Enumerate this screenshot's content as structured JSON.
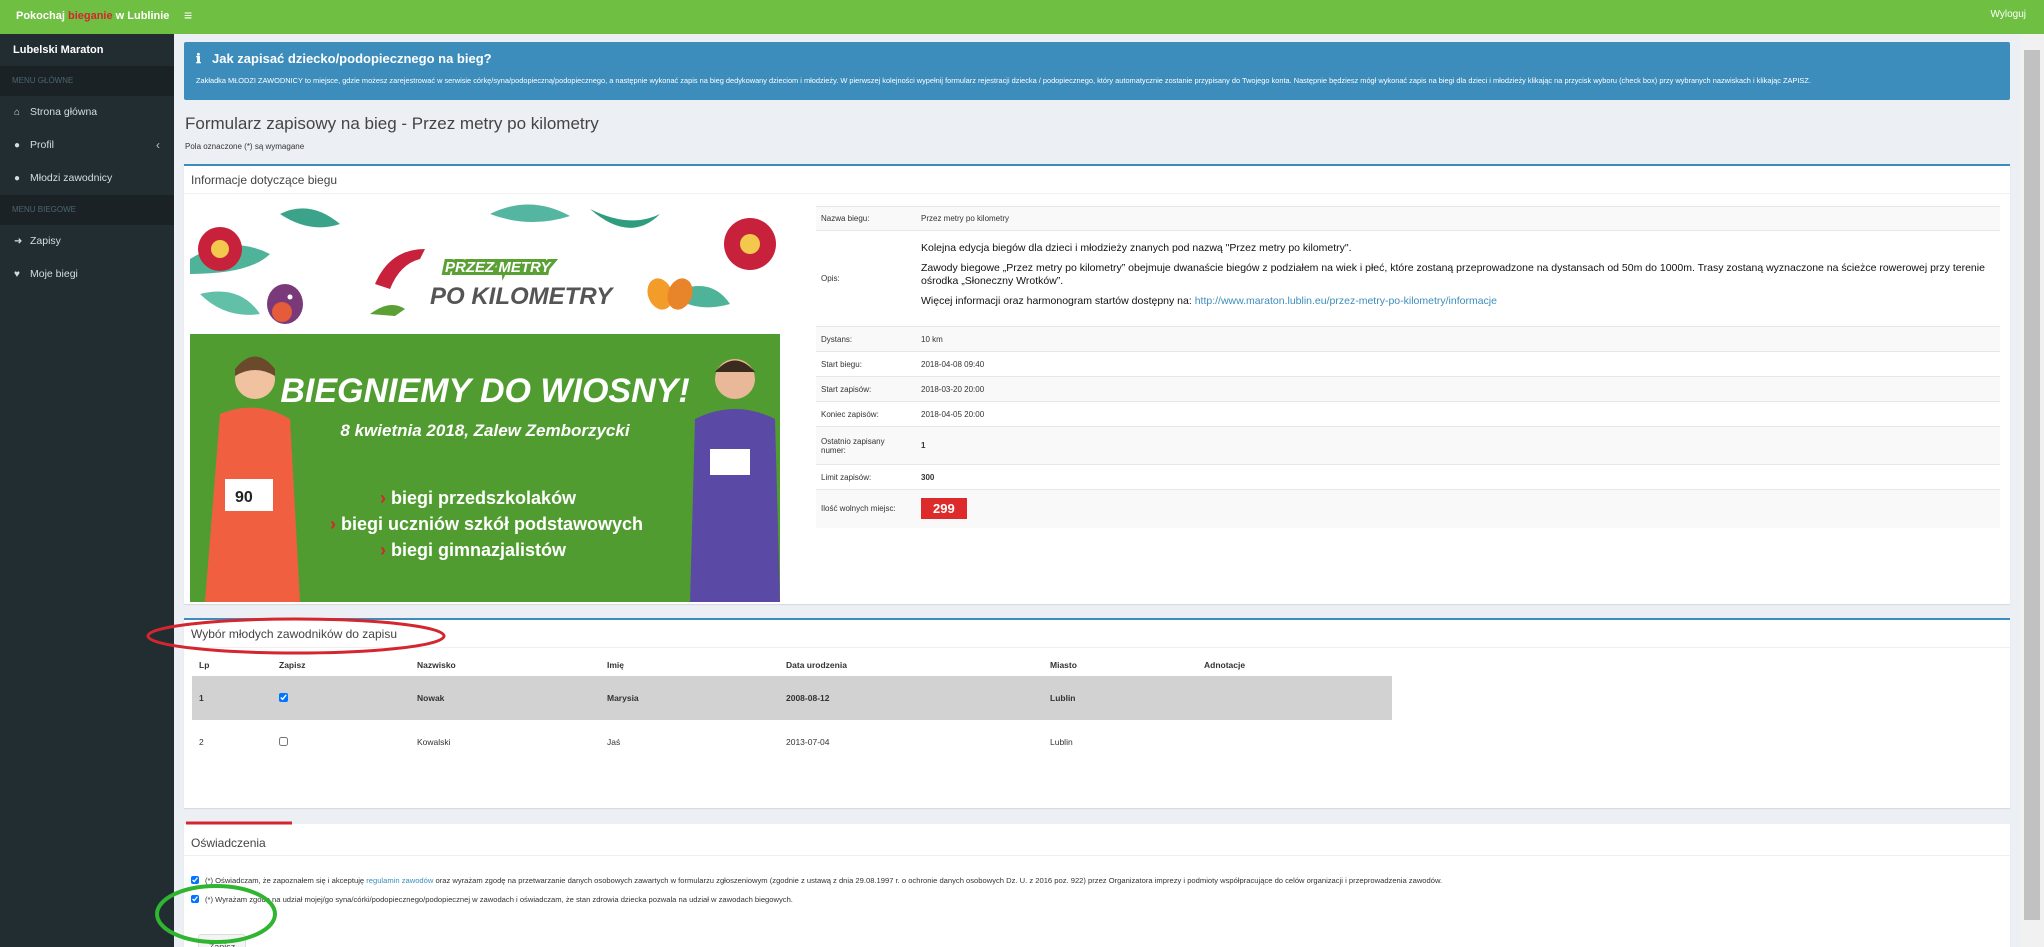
{
  "topbar": {
    "brand_pre": "Pokochaj ",
    "brand_hl": "bieganie",
    "brand_post": " w Lublinie",
    "logout": "Wyloguj",
    "brand_highlight_color": "#d3262e",
    "bar_color": "#6fc042"
  },
  "sidebar": {
    "user": "Lubelski Maraton",
    "header_main": "MENU GŁÓWNE",
    "header_runs": "MENU BIEGOWE",
    "items": [
      {
        "label": "Strona główna",
        "icon": "home-icon"
      },
      {
        "label": "Profil",
        "icon": "user-icon"
      },
      {
        "label": "Młodzi zawodnicy",
        "icon": "users-icon"
      },
      {
        "label": "Zapisy",
        "icon": "sign-in-icon"
      },
      {
        "label": "Moje biegi",
        "icon": "heart-icon"
      }
    ]
  },
  "callout": {
    "title": "Jak zapisać dziecko/podopiecznego na bieg?",
    "text": "Zakładka MŁODZI ZAWODNICY to miejsce, gdzie możesz zarejestrować w serwisie córkę/syna/podopieczną/podopiecznego, a następnie wykonać zapis na bieg dedykowany dzieciom i młodzieży. W pierwszej kolejności wypełnij formularz rejestracji dziecka / podopiecznego, który automatycznie zostanie przypisany do Twojego konta. Następnie będziesz mógł wykonać zapis na biegi dla dzieci i młodzieży klikając na przycisk wyboru (check box) przy wybranych nazwiskach i klikając ZAPISZ.",
    "color": "#3c8dbc"
  },
  "page": {
    "title": "Formularz zapisowy na bieg - Przez metry po kilometry",
    "subtitle": "Pola oznaczone (*) są wymagane"
  },
  "info_box": {
    "title": "Informacje dotyczące biegu",
    "banner": {
      "logo_top": "PRZEZ METRY",
      "logo_bottom": "PO KILOMETRY",
      "headline": "BIEGNIEMY DO WIOSNY!",
      "date": "8 kwietnia 2018, Zalew Zemborzycki",
      "bullets": [
        "biegi przedszkolaków",
        "biegi uczniów szkół podstawowych",
        "biegi gimnazjalistów"
      ],
      "bib": "90"
    },
    "rows": {
      "name_label": "Nazwa biegu:",
      "name": "Przez metry po kilometry",
      "opis_label": "Opis:",
      "opis_p1": "Kolejna edycja biegów dla dzieci i młodzieży  znanych pod nazwą \"Przez metry po kilometry\".",
      "opis_p2": "Zawody biegowe „Przez metry po kilometry” obejmuje dwanaście biegów z podziałem na wiek i płeć, które zostaną przeprowadzone na dystansach od 50m do 1000m. Trasy zostaną wyznaczone na ścieżce rowerowej przy terenie ośrodka „Słoneczny Wrotków”.",
      "opis_p3": "Więcej informacji oraz harmonogram startów dostępny na: ",
      "opis_link": "http://www.maraton.lublin.eu/przez-metry-po-kilometry/informacje",
      "distance_label": "Dystans:",
      "distance": "10 km",
      "start_label": "Start biegu:",
      "start": "2018-04-08 09:40",
      "reg_start_label": "Start zapisów:",
      "reg_start": "2018-03-20 20:00",
      "reg_end_label": "Koniec zapisów:",
      "reg_end": "2018-04-05 20:00",
      "last_no_label": "Ostatnio zapisany numer:",
      "last_no": "1",
      "limit_label": "Limit zapisów:",
      "limit": "300",
      "free_label": "Ilość wolnych miejsc:",
      "free": "299",
      "badge_color": "#dd2a2a"
    }
  },
  "runners_box": {
    "title": "Wybór młodych zawodników do zapisu",
    "headers": [
      "Lp",
      "Zapisz",
      "Nazwisko",
      "Imię",
      "Data urodzenia",
      "Miasto",
      "Adnotacje"
    ],
    "rows": [
      {
        "lp": "1",
        "checked": true,
        "nazwisko": "Nowak",
        "imie": "Marysia",
        "data": "2008-08-12",
        "miasto": "Lublin",
        "adnotacje": ""
      },
      {
        "lp": "2",
        "checked": false,
        "nazwisko": "Kowalski",
        "imie": "Jaś",
        "data": "2013-07-04",
        "miasto": "Lublin",
        "adnotacje": ""
      }
    ]
  },
  "declarations": {
    "title": "Oświadczenia",
    "d1_pre": "(*) Oświadczam, że zapoznałem się i akceptuję ",
    "d1_link": "regulamin zawodów",
    "d1_post": " oraz wyrażam zgodę na przetwarzanie danych osobowych zawartych w formularzu zgłoszeniowym (zgodnie z ustawą z dnia 29.08.1997 r. o ochronie danych osobowych Dz. U. z 2016 poz. 922) przez Organizatora imprezy i podmioty współpracujące do celów organizacji i przeprowadzenia zawodów.",
    "d2": "(*) Wyrażam zgodę na udział mojej/go syna/córki/podopiecznego/podopiecznej w zawodach i oświadczam, że stan zdrowia dziecka pozwala na udział w zawodach biegowych.",
    "submit": "Zapisz"
  },
  "annotations": {
    "red_ellipse_color": "#d3262e",
    "green_ellipse_color": "#2fb52f"
  }
}
